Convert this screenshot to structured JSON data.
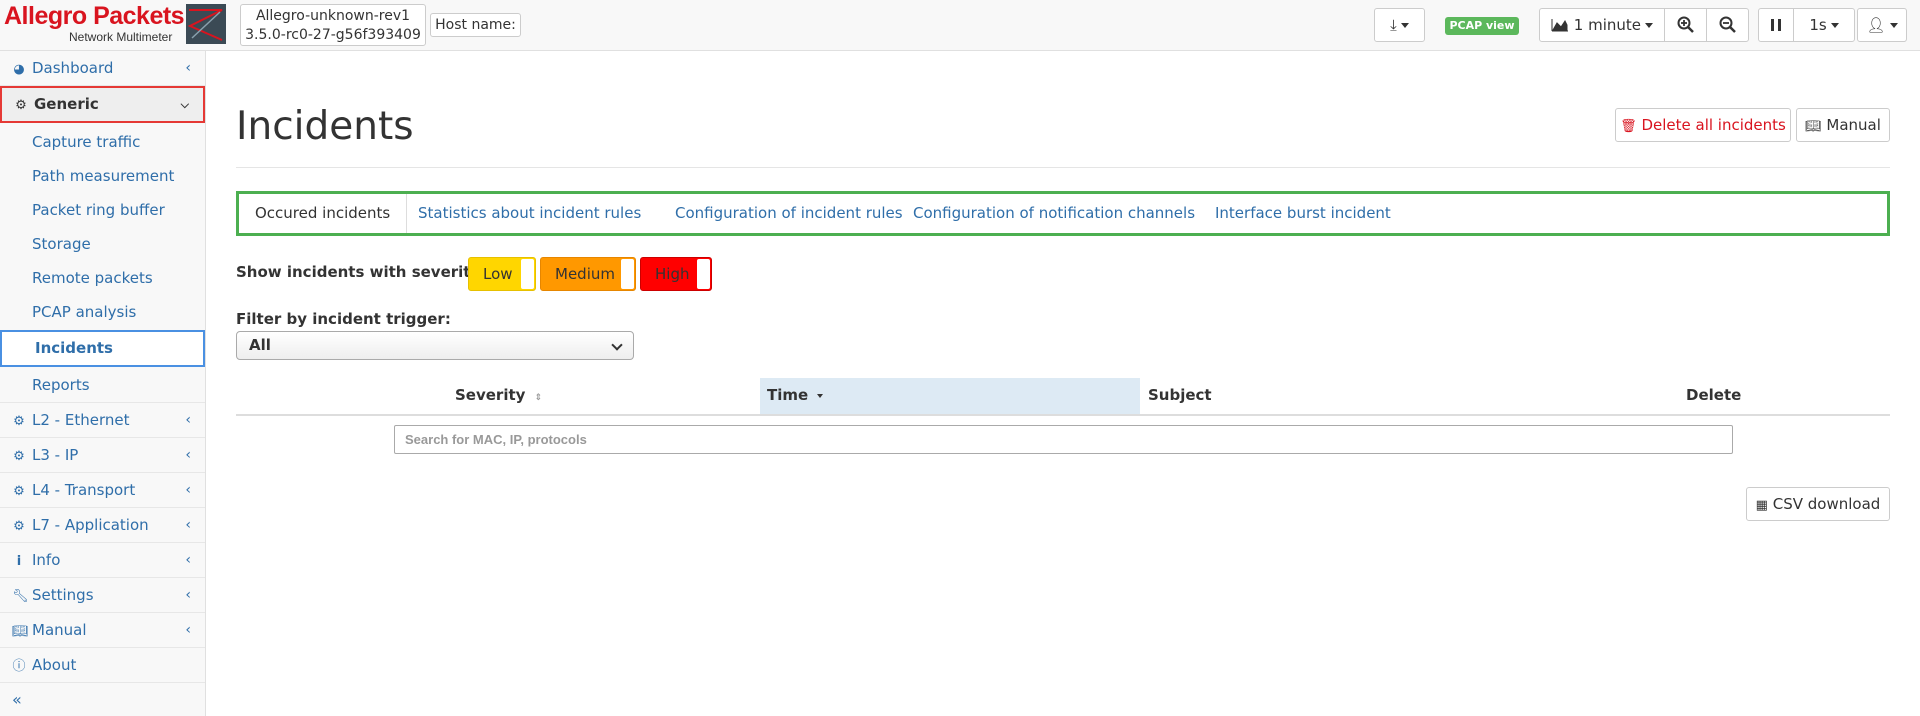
{
  "header": {
    "logo_title": "Allegro Packets",
    "logo_subtitle": "Network Multimeter",
    "device_name": "Allegro-unknown-rev1",
    "device_version": "3.5.0-rc0-27-g56f393409",
    "host_label": "Host name:",
    "pcap_view_label": "PCAP view",
    "interval_label": "1 minute",
    "refresh_label": "1s"
  },
  "sidebar": {
    "items": [
      {
        "label": "Dashboard",
        "icon": "dashboard-icon"
      },
      {
        "label": "Generic",
        "icon": "gear-icon"
      },
      {
        "label": "Capture traffic"
      },
      {
        "label": "Path measurement"
      },
      {
        "label": "Packet ring buffer"
      },
      {
        "label": "Storage"
      },
      {
        "label": "Remote packets"
      },
      {
        "label": "PCAP analysis"
      },
      {
        "label": "Incidents"
      },
      {
        "label": "Reports"
      },
      {
        "label": "L2 - Ethernet",
        "icon": "gear-icon"
      },
      {
        "label": "L3 - IP",
        "icon": "gear-icon"
      },
      {
        "label": "L4 - Transport",
        "icon": "gear-icon"
      },
      {
        "label": "L7 - Application",
        "icon": "gear-icon"
      },
      {
        "label": "Info",
        "icon": "info-icon"
      },
      {
        "label": "Settings",
        "icon": "wrench-icon"
      },
      {
        "label": "Manual",
        "icon": "book-icon"
      },
      {
        "label": "About",
        "icon": "info-circle-icon"
      }
    ],
    "collapse_label": "«"
  },
  "main": {
    "title": "Incidents",
    "delete_all_label": "Delete all incidents",
    "manual_label": "Manual",
    "tabs": [
      {
        "label": "Occured incidents"
      },
      {
        "label": "Statistics about incident rules"
      },
      {
        "label": "Configuration of incident rules"
      },
      {
        "label": "Configuration of notification channels"
      },
      {
        "label": "Interface burst incident"
      }
    ],
    "severity_label": "Show incidents with severity",
    "severity_toggles": [
      {
        "label": "Low",
        "color": "#ffd600"
      },
      {
        "label": "Medium",
        "color": "#ff9800"
      },
      {
        "label": "High",
        "color": "#ff0000"
      }
    ],
    "filter_label": "Filter by incident trigger:",
    "filter_value": "All",
    "table": {
      "columns": [
        "Severity",
        "Time",
        "Subject",
        "Delete"
      ],
      "search_placeholder": "Search for MAC, IP, protocols"
    },
    "csv_label": "CSV download"
  },
  "colors": {
    "accent": "#2f6ea9",
    "brand": "#d9141f",
    "tabs_border": "#4caf50",
    "sort_column_bg": "#ddeaf4"
  }
}
